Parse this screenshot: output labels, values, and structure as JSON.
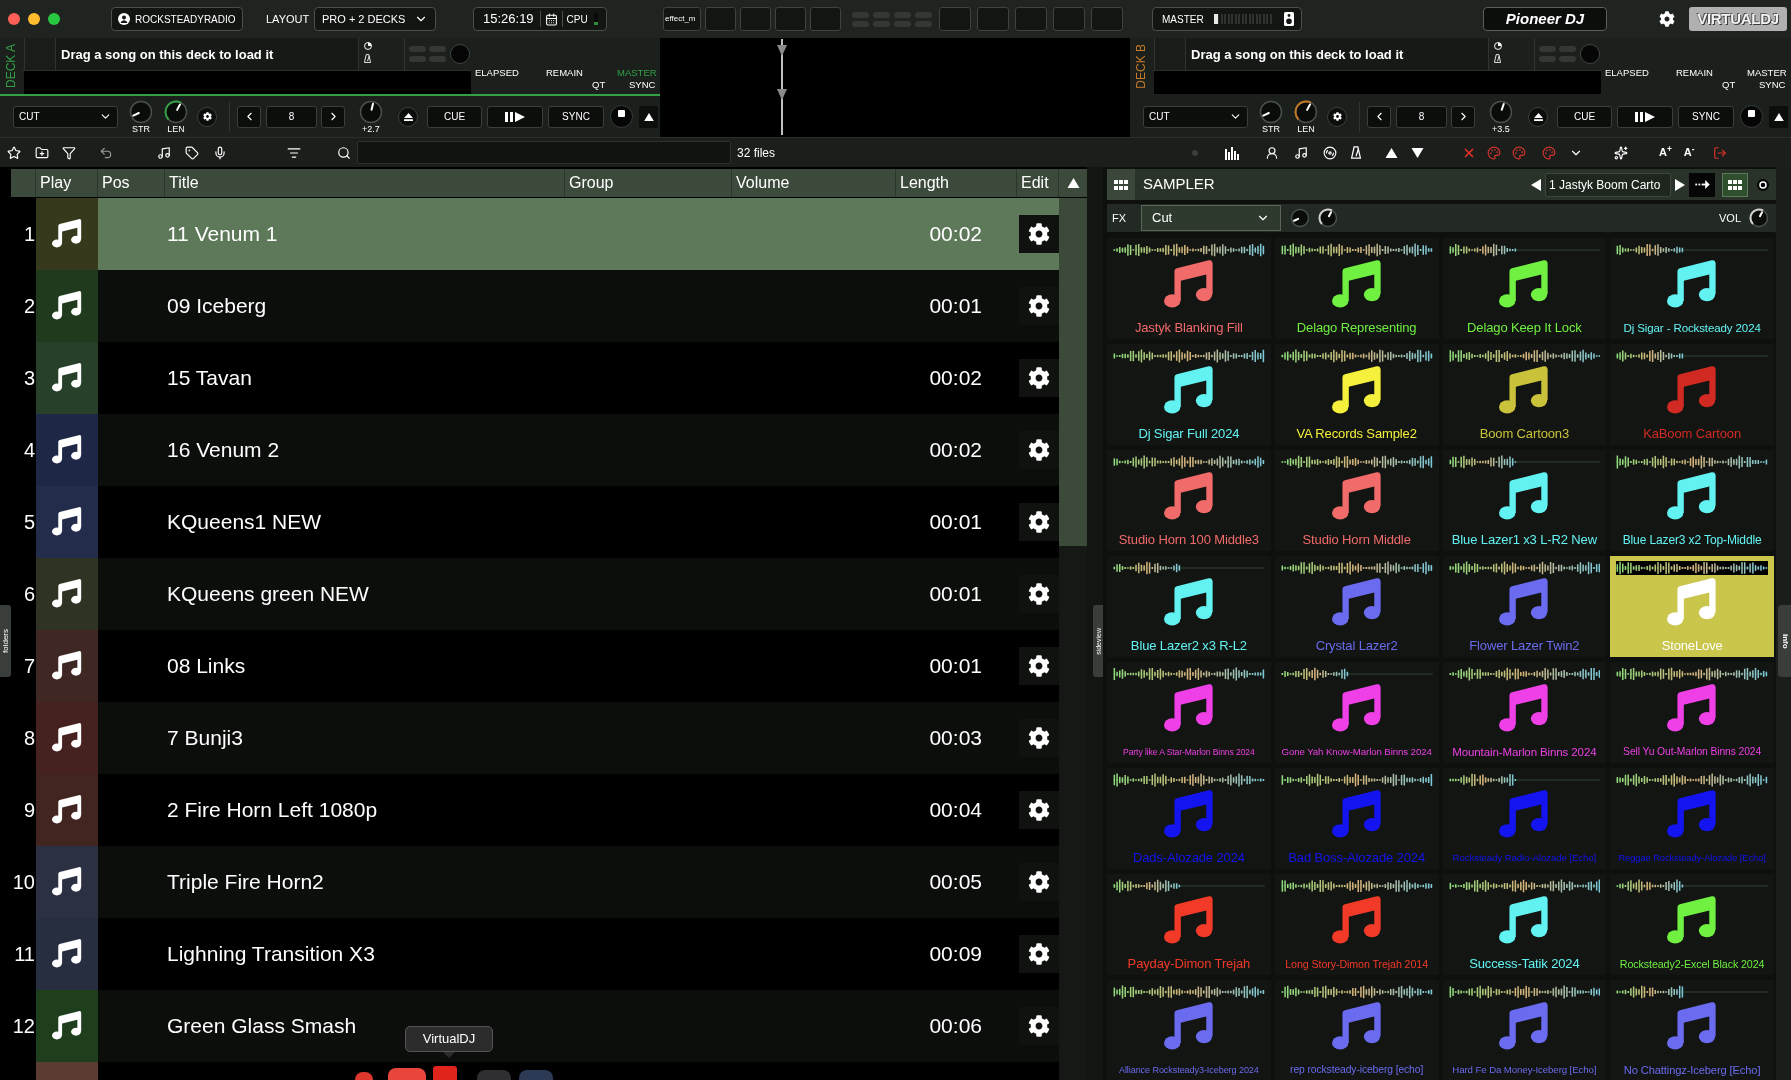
{
  "window": {
    "buttons": [
      {
        "color": "#fe5f57"
      },
      {
        "color": "#febc2e"
      },
      {
        "color": "#28c840"
      }
    ]
  },
  "top_bar": {
    "account": "ROCKSTEADYRADIO",
    "layout_label": "LAYOUT",
    "layout": "PRO + 2 DECKS",
    "clock": "15:26:19",
    "cpu": {
      "label": "CPU",
      "level": 0.25
    },
    "effect_slot": "effect_m",
    "master": {
      "label": "MASTER",
      "level": 0.07
    },
    "brand": "Pioneer DJ",
    "app_name": "VIRTUALDJ"
  },
  "decks": [
    {
      "label": "DECK A",
      "color": "#33a046",
      "master": true,
      "prompt": "Drag a song on this deck to load it",
      "elapsed_label": "ELAPSED",
      "remain_label": "REMAIN",
      "qt_label": "QT",
      "master_label": "MASTER",
      "sync_label": "SYNC",
      "loop_mode": "CUT",
      "knobs": [
        {
          "label": "STR",
          "kind": "plain"
        },
        {
          "label": "LEN",
          "kind": "arc"
        }
      ],
      "loop_size": "8",
      "pitch": {
        "label": "+2.7",
        "level": 0.55
      },
      "cue": "CUE",
      "sync": "SYNC"
    },
    {
      "label": "DECK B",
      "color": "#c47a28",
      "master": false,
      "prompt": "Drag a song on this deck to load it",
      "elapsed_label": "ELAPSED",
      "remain_label": "REMAIN",
      "qt_label": "QT",
      "master_label": "MASTER",
      "sync_label": "SYNC",
      "loop_mode": "CUT",
      "knobs": [
        {
          "label": "STR",
          "kind": "plain"
        },
        {
          "label": "LEN",
          "kind": "arc"
        }
      ],
      "loop_size": "8",
      "pitch": {
        "label": "+3.5",
        "level": 0.57
      },
      "cue": "CUE",
      "sync": "SYNC"
    }
  ],
  "browser": {
    "file_count": "32 files",
    "font_buttons": [
      "A$^{+}$",
      "A$^{-}$"
    ]
  },
  "table": {
    "columns": [
      "Play",
      "Pos",
      "Title",
      "Group",
      "Volume",
      "Length",
      "Edit"
    ],
    "rows": [
      {
        "number": "1",
        "title": "11 Venum 1",
        "length": "00:02",
        "selected": true,
        "color": "#36391c"
      },
      {
        "number": "2",
        "title": "09 Iceberg",
        "length": "00:01",
        "selected": false,
        "color": "#1f3a1c"
      },
      {
        "number": "3",
        "title": "15 Tavan",
        "length": "00:02",
        "selected": false,
        "color": "#26402a"
      },
      {
        "number": "4",
        "title": "16 Venum 2",
        "length": "00:02",
        "selected": false,
        "color": "#1e2846"
      },
      {
        "number": "5",
        "title": "KQueens1 NEW",
        "length": "00:01",
        "selected": false,
        "color": "#242c4c"
      },
      {
        "number": "6",
        "title": "KQueens green NEW",
        "length": "00:01",
        "selected": false,
        "color": "#2e3324"
      },
      {
        "number": "7",
        "title": "08 Links",
        "length": "00:01",
        "selected": false,
        "color": "#3f2723"
      },
      {
        "number": "8",
        "title": "7 Bunji3",
        "length": "00:03",
        "selected": false,
        "color": "#45211f"
      },
      {
        "number": "9",
        "title": "2 Fire Horn Left 1080p",
        "length": "00:04",
        "selected": false,
        "color": "#422420"
      },
      {
        "number": "10",
        "title": "Triple Fire Horn2",
        "length": "00:05",
        "selected": false,
        "color": "#2b3042"
      },
      {
        "number": "11",
        "title": "Lighning Transition X3",
        "length": "00:09",
        "selected": false,
        "color": "#272e40"
      },
      {
        "number": "12",
        "title": "Green Glass Smash",
        "length": "00:06",
        "selected": false,
        "color": "#1e3e1c"
      },
      {
        "selected": false,
        "color": "#5c3b33"
      }
    ]
  },
  "sampler": {
    "title": "SAMPLER",
    "bank": "1 Jastyk Boom Carto",
    "fx_label": "FX",
    "fx_effect": "Cut",
    "fx_knobs": [
      {
        "kind": "plain"
      },
      {
        "kind": "arc"
      }
    ],
    "volume": {
      "label": "VOL",
      "kind": "arc"
    },
    "pads": [
      {
        "name": "Jastyk Blanking Fill",
        "color": "#f26b6b",
        "selected": false
      },
      {
        "name": "Delago Representing",
        "color": "#70f040",
        "selected": false
      },
      {
        "name": "Delago Keep It Lock",
        "color": "#70f040",
        "selected": false
      },
      {
        "name": "Dj Sigar - Rocksteady 2024",
        "color": "#62f2f2",
        "selected": false
      },
      {
        "name": "Dj Sigar Full 2024",
        "color": "#62f2f2",
        "selected": false
      },
      {
        "name": "VA Records Sample2",
        "color": "#f4f03c",
        "selected": false
      },
      {
        "name": "Boom Cartoon3",
        "color": "#c9c23a",
        "selected": false
      },
      {
        "name": "KaBoom Cartoon",
        "color": "#d12a22",
        "selected": false
      },
      {
        "name": "Studio Horn 100 Middle3",
        "color": "#f26b6b",
        "selected": false
      },
      {
        "name": "Studio Horn Middle",
        "color": "#f26b6b",
        "selected": false
      },
      {
        "name": "Blue Lazer1 x3 L-R2 New",
        "color": "#62f2f2",
        "selected": false
      },
      {
        "name": "Blue Lazer3 x2 Top-Middle",
        "color": "#62f2f2",
        "selected": false
      },
      {
        "name": "Blue Lazer2 x3 R-L2",
        "color": "#62f2f2",
        "selected": false
      },
      {
        "name": "Crystal Lazer2",
        "color": "#6b6bf0",
        "selected": false
      },
      {
        "name": "Flower Lazer Twin2",
        "color": "#6b6bf0",
        "selected": false
      },
      {
        "name": "StoneLove",
        "color": "#c9c64b",
        "selected": true
      },
      {
        "name": "Party like A Star-Marlon Binns 2024",
        "color": "#ee40e6",
        "selected": false
      },
      {
        "name": "Gone Yah Know-Marlon Binns 2024",
        "color": "#ee40e6",
        "selected": false
      },
      {
        "name": "Mountain-Marlon Binns 2024",
        "color": "#ee40e6",
        "selected": false
      },
      {
        "name": "Sell Yu Out-Marlon Binns 2024",
        "color": "#ee40e6",
        "selected": false
      },
      {
        "name": "Dads-Alozade 2024",
        "color": "#1414f0",
        "selected": false
      },
      {
        "name": "Bad Boss-Alozade 2024",
        "color": "#1414f0",
        "selected": false
      },
      {
        "name": "Rocksteady Radio-Alozade [Echo]",
        "color": "#1414f0",
        "selected": false
      },
      {
        "name": "Reggae Rocksteady-Alozade [Echo]",
        "color": "#1414f0",
        "selected": false
      },
      {
        "name": "Payday-Dimon Trejah",
        "color": "#f23a28",
        "selected": false
      },
      {
        "name": "Long Story-Dimon Trejah 2014",
        "color": "#f23a28",
        "selected": false
      },
      {
        "name": "Success-Tatik 2024",
        "color": "#62f2f2",
        "selected": false
      },
      {
        "name": "Rocksteady2-Excel Black 2024",
        "color": "#70f040",
        "selected": false
      },
      {
        "name": "Alliance Rocksteady3-Iceberg 2024",
        "color": "#6b6bf0",
        "selected": false
      },
      {
        "name": "rep rocksteady-iceberg [echo]",
        "color": "#6b6bf0",
        "selected": false
      },
      {
        "name": "Hard Fe Da Money-Iceberg [Echo]",
        "color": "#6b6bf0",
        "selected": false
      },
      {
        "name": "No Chattingz-Iceberg [Echo]",
        "color": "#6b6bf0",
        "selected": false
      }
    ]
  },
  "side_tabs": {
    "left": "folders",
    "middle": "sideview",
    "right": "info"
  },
  "dock": {
    "tooltip": "VirtualDJ"
  }
}
